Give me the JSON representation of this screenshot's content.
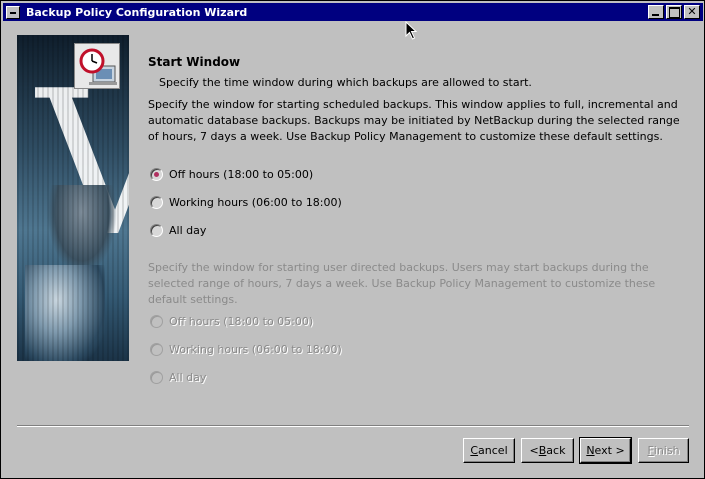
{
  "window": {
    "title": "Backup Policy Configuration Wizard"
  },
  "page": {
    "heading": "Start Window",
    "subheading": "Specify the time window during which backups are allowed to start."
  },
  "scheduled": {
    "description": "Specify the window for starting scheduled backups. This window applies to full, incremental and automatic database backups. Backups may be initiated by NetBackup during the selected range of hours, 7 days a week. Use Backup Policy Management to customize these default settings.",
    "options": [
      {
        "label": "Off hours (18:00 to 05:00)",
        "selected": true
      },
      {
        "label": "Working hours (06:00 to 18:00)",
        "selected": false
      },
      {
        "label": "All day",
        "selected": false
      }
    ]
  },
  "user_directed": {
    "description": "Specify the window for starting user directed backups. Users may start backups during the selected range of hours, 7 days a week. Use Backup Policy Management to customize these default settings.",
    "options": [
      {
        "label": "Off hours (18:00 to 05:00)",
        "selected": false
      },
      {
        "label": "Working hours (06:00 to 18:00)",
        "selected": false
      },
      {
        "label": "All day",
        "selected": false
      }
    ]
  },
  "buttons": {
    "cancel": {
      "pre": "",
      "u": "C",
      "post": "ancel"
    },
    "back": {
      "pre": "< ",
      "u": "B",
      "post": "ack"
    },
    "next": {
      "pre": "",
      "u": "N",
      "post": "ext >"
    },
    "finish": {
      "pre": "",
      "u": "F",
      "post": "inish"
    }
  },
  "sidebar": {
    "letter": "V"
  },
  "colors": {
    "titlebar": "#000080",
    "radio_dot": "#b03060",
    "disabled_text": "#8a8a8a"
  }
}
